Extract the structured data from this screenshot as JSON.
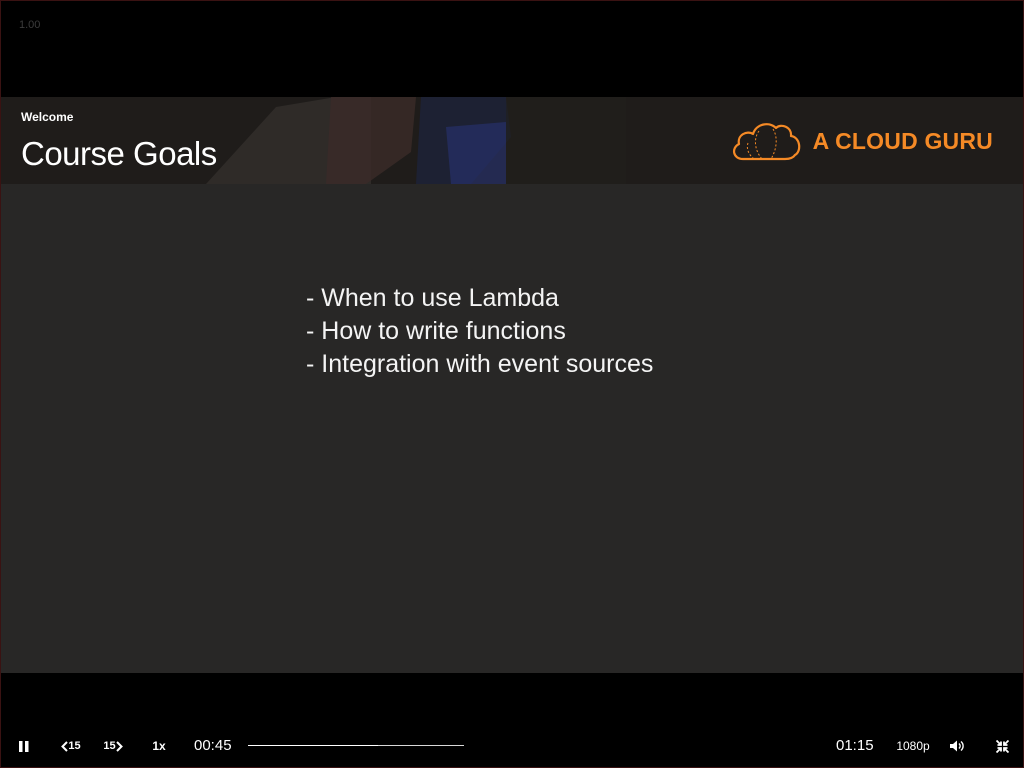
{
  "player": {
    "speed_readout": "1.00",
    "progress_fraction": 0.6
  },
  "slide": {
    "section_label": "Welcome",
    "title": "Course Goals",
    "brand_name": "A CLOUD GURU",
    "bullets": [
      "- When to use Lambda",
      "- How to write functions",
      "- Integration with event sources"
    ]
  },
  "controls": {
    "pause_icon": "pause-icon",
    "skip_back_label": "15",
    "skip_forward_label": "15",
    "playback_rate": "1x",
    "current_time": "00:45",
    "total_time": "01:15",
    "quality": "1080p",
    "volume_icon": "volume-icon",
    "fullscreen_icon": "exit-fullscreen-icon"
  },
  "colors": {
    "brand_orange": "#f58a26",
    "slide_background": "#282726",
    "header_background": "#1f1c1a",
    "player_background": "#000000"
  }
}
